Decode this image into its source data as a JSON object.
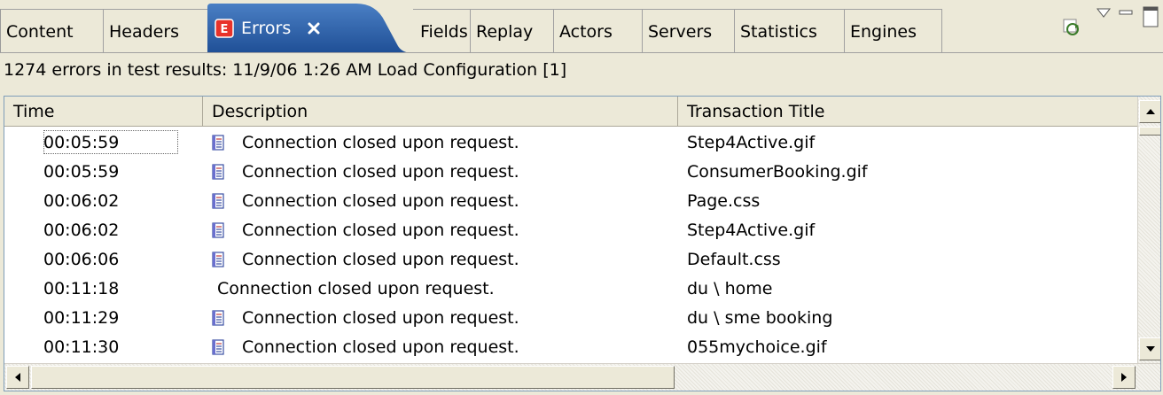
{
  "tabs": [
    {
      "label": "Content",
      "active": false
    },
    {
      "label": "Headers",
      "active": false
    },
    {
      "label": "Errors",
      "active": true
    },
    {
      "label": "Fields",
      "active": false
    },
    {
      "label": "Replay",
      "active": false
    },
    {
      "label": "Actors",
      "active": false
    },
    {
      "label": "Servers",
      "active": false
    },
    {
      "label": "Statistics",
      "active": false
    },
    {
      "label": "Engines",
      "active": false
    }
  ],
  "toolbar_icons": [
    "refresh-icon",
    "view-menu-icon",
    "minimize-icon",
    "maximize-icon"
  ],
  "errors_icon_letter": "E",
  "status_text": "1274 errors in test results: 11/9/06 1:26 AM Load Configuration [1]",
  "columns": [
    "Time",
    "Description",
    "Transaction Title"
  ],
  "rows": [
    {
      "time": "00:05:59",
      "description": "Connection closed upon request.",
      "title": "Step4Active.gif",
      "icon": true
    },
    {
      "time": "00:05:59",
      "description": "Connection closed upon request.",
      "title": "ConsumerBooking.gif",
      "icon": true
    },
    {
      "time": "00:06:02",
      "description": "Connection closed upon request.",
      "title": "Page.css",
      "icon": true
    },
    {
      "time": "00:06:02",
      "description": "Connection closed upon request.",
      "title": "Step4Active.gif",
      "icon": true
    },
    {
      "time": "00:06:06",
      "description": "Connection closed upon request.",
      "title": "Default.css",
      "icon": true
    },
    {
      "time": "00:11:18",
      "description": "Connection closed upon request.",
      "title": "du \\ home",
      "icon": false
    },
    {
      "time": "00:11:29",
      "description": "Connection closed upon request.",
      "title": "du \\ sme booking",
      "icon": true
    },
    {
      "time": "00:11:30",
      "description": "Connection closed upon request.",
      "title": "055mychoice.gif",
      "icon": true
    }
  ],
  "colors": {
    "active_tab": "#2a5fa8",
    "error_badge": "#e8322a",
    "frame": "#7f9db9"
  }
}
